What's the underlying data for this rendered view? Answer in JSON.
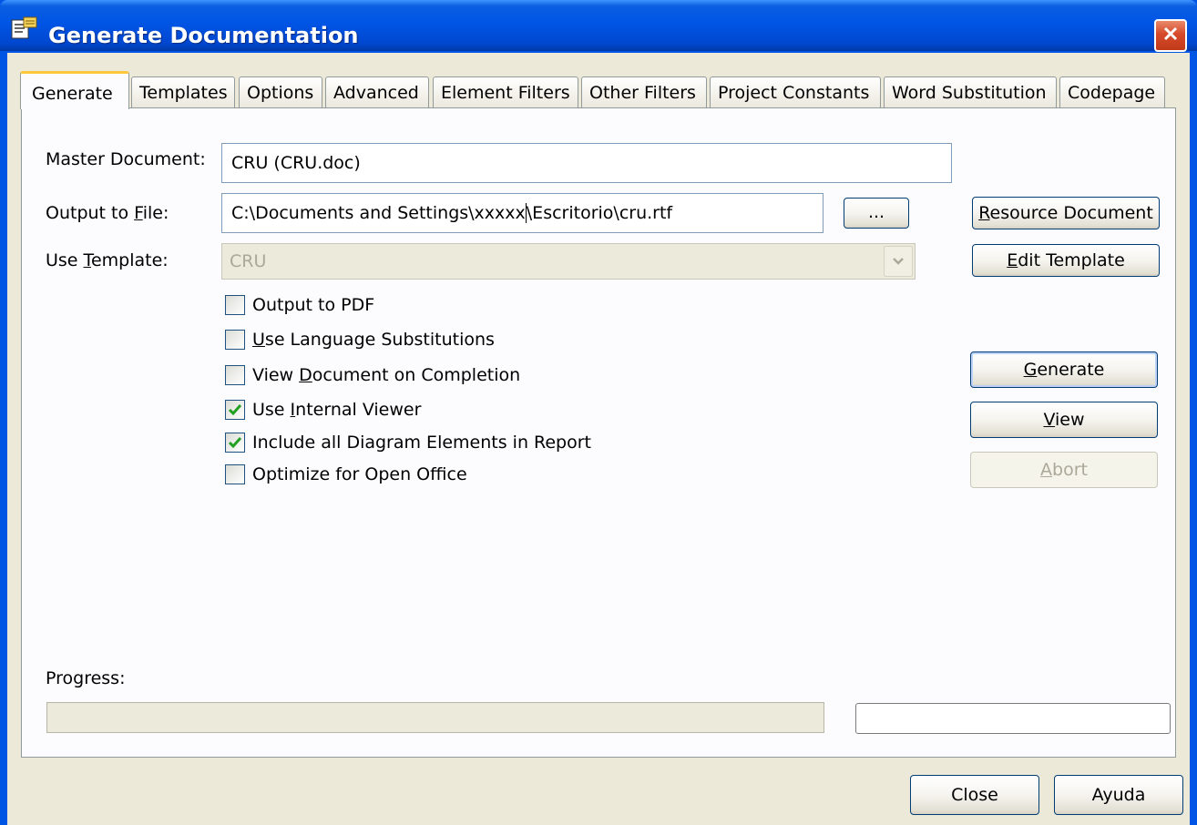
{
  "window": {
    "title": "Generate Documentation",
    "icon": "document-settings-icon",
    "close_icon": "close-icon"
  },
  "tabs": [
    {
      "label": "Generate",
      "active": true
    },
    {
      "label": "Templates"
    },
    {
      "label": "Options"
    },
    {
      "label": "Advanced"
    },
    {
      "label": "Element Filters"
    },
    {
      "label": "Other Filters"
    },
    {
      "label": "Project Constants"
    },
    {
      "label": "Word Substitution"
    },
    {
      "label": "Codepage"
    }
  ],
  "form": {
    "master_document_label": "Master Document:",
    "master_document_value": "CRU (CRU.doc)",
    "output_file_label_pre": "Output to ",
    "output_file_label_u": "F",
    "output_file_label_post": "ile:",
    "output_file_value_a": "C:\\Documents and Settings\\xxxxx",
    "output_file_value_b": "\\Escritorio\\cru.rtf",
    "browse_label": "...",
    "use_template_label_pre": "Use ",
    "use_template_label_u": "T",
    "use_template_label_post": "emplate:",
    "use_template_value": "CRU"
  },
  "checkboxes": [
    {
      "pre": "",
      "u": "",
      "post": "Output to PDF",
      "checked": false
    },
    {
      "pre": "",
      "u": "U",
      "post": "se Language Substitutions",
      "checked": false
    },
    {
      "pre": "View ",
      "u": "D",
      "post": "ocument on Completion",
      "checked": false
    },
    {
      "pre": "Use ",
      "u": "I",
      "post": "nternal Viewer",
      "checked": true
    },
    {
      "pre": "Include all Diagram Elements in Report",
      "u": "",
      "post": "",
      "checked": true
    },
    {
      "pre": "Optimize for Open Office",
      "u": "",
      "post": "",
      "checked": false
    }
  ],
  "buttons": {
    "resource_document": {
      "u": "R",
      "post": "esource Document"
    },
    "edit_template": {
      "u": "E",
      "post": "dit Template"
    },
    "generate": {
      "u": "G",
      "post": "enerate"
    },
    "view": {
      "u": "V",
      "post": "iew"
    },
    "abort": {
      "u": "A",
      "post": "bort",
      "disabled": true
    },
    "close": "Close",
    "help": "Ayuda"
  },
  "progress": {
    "label": "Progress:",
    "value": 0
  },
  "colors": {
    "titlebar": "#0055e5",
    "face": "#ece9d8",
    "check": "#21a121",
    "close_button": "#d64a2a"
  }
}
